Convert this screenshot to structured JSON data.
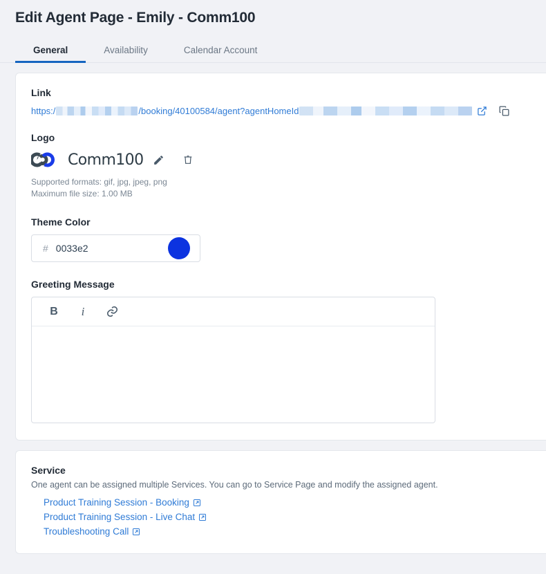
{
  "header": {
    "title": "Edit Agent Page - Emily - Comm100"
  },
  "tabs": [
    {
      "label": "General",
      "active": true
    },
    {
      "label": "Availability",
      "active": false
    },
    {
      "label": "Calendar Account",
      "active": false
    }
  ],
  "general": {
    "link": {
      "label": "Link",
      "prefix": "https:/",
      "middle": "/booking/40100584/agent?agentHomeId",
      "redacted": true,
      "open_icon": "external-link-icon",
      "copy_icon": "copy-icon"
    },
    "logo": {
      "label": "Logo",
      "wordmark": "Comm100",
      "edit_icon": "pencil-icon",
      "delete_icon": "trash-icon",
      "supported_formats": "Supported formats: gif, jpg, jpeg, png",
      "max_file_size": "Maximum file size: 1.00 MB",
      "mark_dark_color": "#3c4a54",
      "mark_blue_color": "#1a3ce8"
    },
    "theme_color": {
      "label": "Theme Color",
      "hash": "#",
      "value": "0033e2",
      "swatch_color": "#0c33e0"
    },
    "greeting": {
      "label": "Greeting Message",
      "toolbar": [
        {
          "name": "bold-icon",
          "glyph": "B"
        },
        {
          "name": "italic-icon",
          "glyph": "i"
        },
        {
          "name": "link-icon",
          "glyph": "link"
        }
      ],
      "value": ""
    }
  },
  "service": {
    "label": "Service",
    "description": "One agent can be assigned multiple Services. You can go to Service Page and modify the assigned agent.",
    "items": [
      {
        "label": "Product Training Session - Booking"
      },
      {
        "label": "Product Training Session - Live Chat"
      },
      {
        "label": "Troubleshooting Call"
      }
    ]
  },
  "colors": {
    "page_bg": "#f1f2f6",
    "card_bg": "#ffffff",
    "accent": "#1565c0",
    "link": "#2f7bd6"
  }
}
